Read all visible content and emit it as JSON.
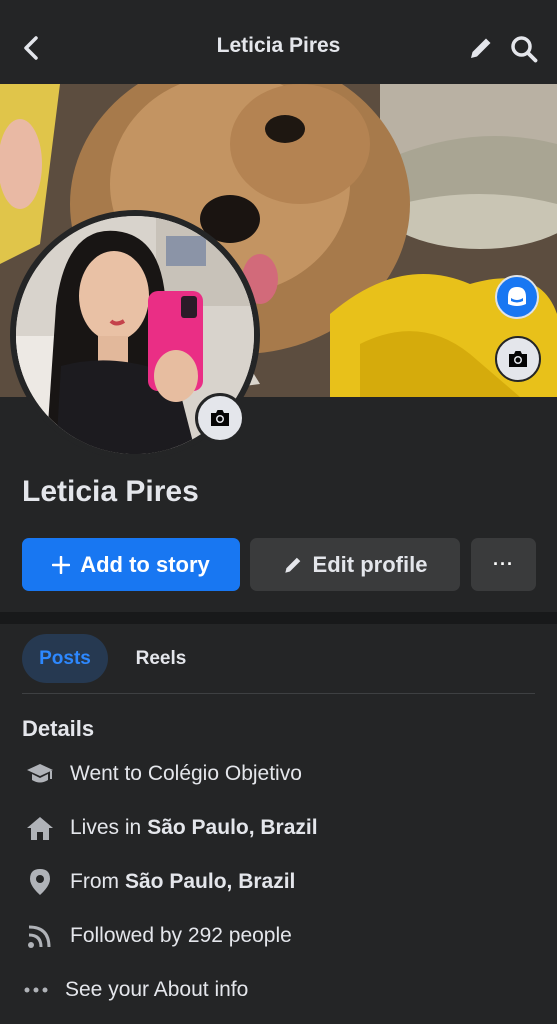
{
  "header": {
    "title": "Leticia Pires",
    "back_icon": "chevron-left-icon",
    "edit_icon": "pencil-icon",
    "search_icon": "search-icon"
  },
  "profile": {
    "name": "Leticia Pires"
  },
  "actions": {
    "add_story_label": "Add to story",
    "edit_profile_label": "Edit profile",
    "more_label": "···"
  },
  "tabs": [
    {
      "label": "Posts",
      "active": true
    },
    {
      "label": "Reels",
      "active": false
    }
  ],
  "details": {
    "title": "Details",
    "items": [
      {
        "icon": "graduation-cap-icon",
        "prefix": "Went to Colégio Objetivo",
        "bold": ""
      },
      {
        "icon": "home-icon",
        "prefix": "Lives in",
        "bold": "São Paulo, Brazil"
      },
      {
        "icon": "location-pin-icon",
        "prefix": "From",
        "bold": "São Paulo, Brazil"
      },
      {
        "icon": "rss-icon",
        "prefix": "Followed by 292 people",
        "bold": ""
      },
      {
        "icon": "more-dots-icon",
        "prefix": "See your About info",
        "bold": ""
      }
    ]
  },
  "colors": {
    "background": "#242526",
    "accent": "#1877f2",
    "secondary_button": "#3a3b3c",
    "text": "#e4e6eb"
  }
}
